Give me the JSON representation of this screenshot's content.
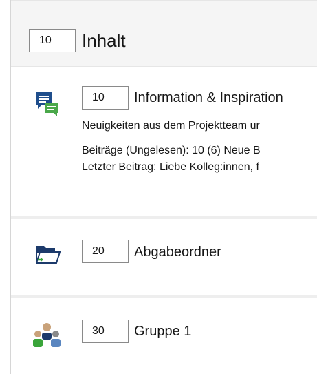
{
  "header": {
    "position_value": "10",
    "title": "Inhalt"
  },
  "items": [
    {
      "icon": "forum-icon",
      "position_value": "10",
      "title": "Information & Inspiration",
      "description": "Neuigkeiten aus dem Projektteam ur",
      "stats": "Beiträge (Ungelesen): 10 (6)   Neue B",
      "last_post": "Letzter Beitrag: Liebe Kolleg:innen,  f"
    },
    {
      "icon": "folder-submission-icon",
      "position_value": "20",
      "title": "Abgabeordner"
    },
    {
      "icon": "group-icon",
      "position_value": "30",
      "title": "Gruppe 1"
    }
  ],
  "colors": {
    "forum_blue": "#1f4e8c",
    "forum_green": "#4aa84a",
    "folder_navy": "#1c3a6b",
    "arrow_green": "#3aa53a",
    "group_tan": "#c9a27a"
  }
}
